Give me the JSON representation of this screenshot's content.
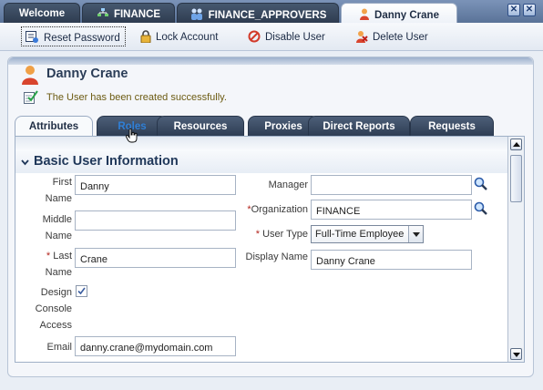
{
  "window_tabs": [
    {
      "label": "Welcome"
    },
    {
      "label": "FINANCE"
    },
    {
      "label": "FINANCE_APPROVERS"
    },
    {
      "label": "Danny Crane"
    }
  ],
  "toolbar": {
    "reset_password": "Reset Password",
    "lock_account": "Lock Account",
    "disable_user": "Disable User",
    "delete_user": "Delete User"
  },
  "user": {
    "name": "Danny Crane",
    "success_message": "The User has been created successfully."
  },
  "tabs": {
    "attributes": "Attributes",
    "roles": "Roles",
    "resources": "Resources",
    "proxies": "Proxies",
    "direct_reports": "Direct Reports",
    "requests": "Requests"
  },
  "section": {
    "title": "Basic User Information"
  },
  "form": {
    "first_name_label_1": "First",
    "first_name_label_2": "Name",
    "first_name_value": "Danny",
    "middle_name_label_1": "Middle",
    "middle_name_label_2": "Name",
    "middle_name_value": "",
    "last_name_req": "*",
    "last_name_label_1": "Last",
    "last_name_label_2": "Name",
    "last_name_value": "Crane",
    "design_label_1": "Design",
    "design_label_2": "Console",
    "design_label_3": "Access",
    "design_checked": true,
    "email_label": "Email",
    "email_value": "danny.crane@mydomain.com",
    "manager_label": "Manager",
    "manager_value": "",
    "organization_req": "*",
    "organization_label": "Organization",
    "organization_value": "FINANCE",
    "user_type_req": "*",
    "user_type_label": "User Type",
    "user_type_value": "Full-Time Employee",
    "display_name_label": "Display Name",
    "display_name_value": "Danny Crane"
  },
  "colors": {
    "tab_dark": "#2e3d54",
    "accent_blue": "#1f3759",
    "success_text": "#6c5b12",
    "required_star": "#b3261e"
  }
}
